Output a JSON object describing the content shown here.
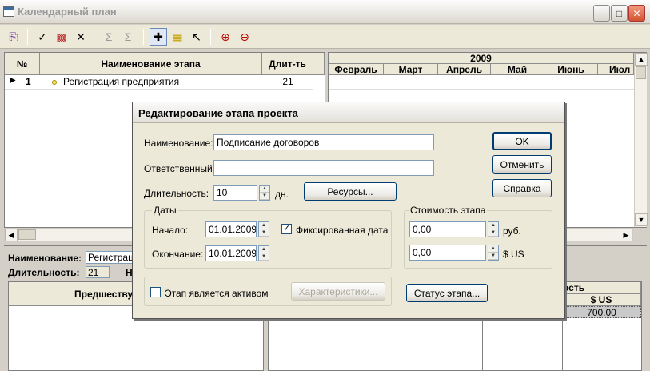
{
  "window": {
    "title": "Календарный план"
  },
  "left_grid": {
    "headers": [
      "№",
      "Наименование этапа",
      "Длит-ть"
    ],
    "rows": [
      {
        "num": "1",
        "name": "Регистрация предприятия",
        "duration": "21"
      }
    ]
  },
  "gantt": {
    "year": "2009",
    "months": [
      "Февраль",
      "Март",
      "Апрель",
      "Май",
      "Июнь",
      "Июл"
    ]
  },
  "bottom": {
    "name_label": "Наименование:",
    "name_value": "Регистраци",
    "duration_label": "Длительность:",
    "duration_value": "21",
    "hidden_label_start": "Н",
    "pred_header": "Предшеству",
    "cost_header": "ость",
    "usd_header": "$ US",
    "usd_value": "700.00"
  },
  "dialog": {
    "title": "Редактирование этапа проекта",
    "name_label": "Наименование:",
    "name_value": "Подписание договоров",
    "responsible_label": "Ответственный:",
    "responsible_value": "",
    "duration_label": "Длительность:",
    "duration_value": "10",
    "duration_unit": "дн.",
    "resources_button": "Ресурсы...",
    "ok_button": "OK",
    "cancel_button": "Отменить",
    "help_button": "Справка",
    "dates_group": "Даты",
    "start_label": "Начало:",
    "start_value": "01.01.2009",
    "fixed_date_label": "Фиксированная дата",
    "end_label": "Окончание:",
    "end_value": "10.01.2009",
    "cost_group": "Стоимость этапа",
    "cost_rub_value": "0,00",
    "cost_rub_unit": "руб.",
    "cost_usd_value": "0,00",
    "cost_usd_unit": "$ US",
    "asset_label": "Этап является активом",
    "characteristics_button": "Характеристики...",
    "status_button": "Статус этапа..."
  }
}
